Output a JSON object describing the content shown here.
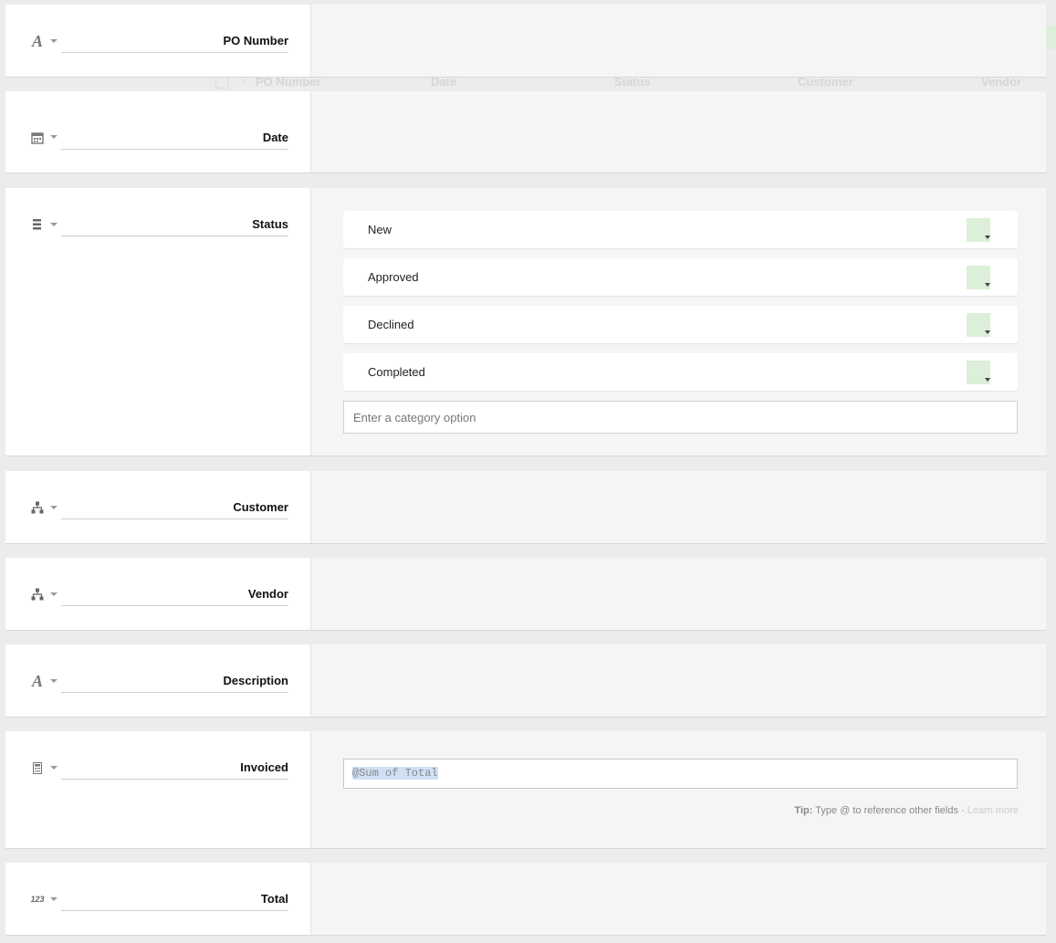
{
  "background_table": {
    "columns": [
      "PO Number",
      "Date",
      "Status",
      "Customer",
      "Vendor"
    ]
  },
  "fields": {
    "po_number": {
      "name": "PO Number",
      "icon": "text-type-icon"
    },
    "date": {
      "name": "Date",
      "icon": "calendar-icon"
    },
    "status": {
      "name": "Status",
      "icon": "category-list-icon",
      "options": [
        "New",
        "Approved",
        "Declined",
        "Completed"
      ],
      "option_color": "#dcefd8",
      "add_option_placeholder": "Enter a category option"
    },
    "customer": {
      "name": "Customer",
      "icon": "link-hierarchy-icon"
    },
    "vendor": {
      "name": "Vendor",
      "icon": "link-hierarchy-icon"
    },
    "description": {
      "name": "Description",
      "icon": "text-type-icon"
    },
    "invoiced": {
      "name": "Invoiced",
      "icon": "calculator-icon",
      "formula": "@Sum of Total",
      "tip_label": "Tip:",
      "tip_text": "Type @ to reference other fields ·",
      "learn_more": "Learn more"
    },
    "total": {
      "name": "Total",
      "icon": "number-type-icon",
      "icon_text": "123"
    }
  }
}
